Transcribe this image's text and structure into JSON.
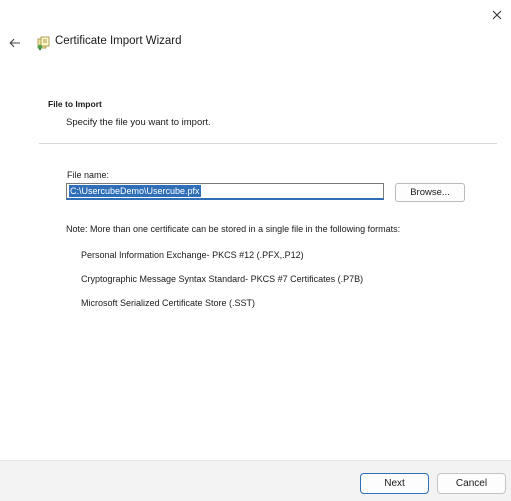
{
  "window": {
    "close_icon": "close-icon",
    "back_icon": "back-arrow-icon",
    "wizard_icon": "certificate-icon",
    "title": "Certificate Import Wizard"
  },
  "section": {
    "title": "File to Import",
    "subtitle": "Specify the file you want to import."
  },
  "file": {
    "label": "File name:",
    "value": "C:\\UsercubeDemo\\Usercube.pfx",
    "browse_label": "Browse..."
  },
  "note": {
    "text": "Note:  More than one certificate can be stored in a single file in the following formats:",
    "formats": [
      "Personal Information Exchange- PKCS #12 (.PFX,.P12)",
      "Cryptographic Message Syntax Standard- PKCS #7 Certificates (.P7B)",
      "Microsoft Serialized Certificate Store (.SST)"
    ]
  },
  "footer": {
    "next_label": "Next",
    "cancel_label": "Cancel"
  },
  "colors": {
    "accent": "#2f6fb8",
    "footer_bg": "#f3f3f3"
  }
}
